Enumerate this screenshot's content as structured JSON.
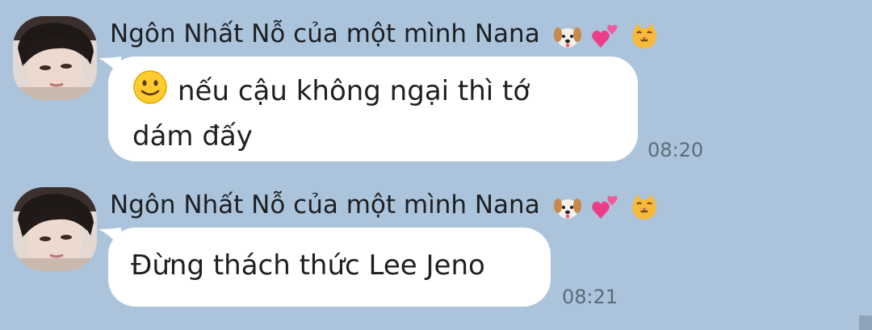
{
  "messages": [
    {
      "sender": "Ngôn Nhất Nỗ của một mình Nana",
      "sender_emojis": [
        "dog-face-emoji",
        "two-hearts-emoji",
        "cat-face-emoji"
      ],
      "leading_emoji": "slightly-smiling-face-emoji",
      "text_line1": "nếu cậu không ngại thì tớ",
      "text_line2": "dám đấy",
      "time": "08:20"
    },
    {
      "sender": "Ngôn Nhất Nỗ của một mình Nana",
      "sender_emojis": [
        "dog-face-emoji",
        "two-hearts-emoji",
        "cat-face-emoji"
      ],
      "text": "Đừng thách thức Lee Jeno",
      "time": "08:21"
    }
  ],
  "colors": {
    "background": "#abc4db",
    "bubble": "#ffffff",
    "text": "#1d1f22",
    "time": "#5d6b78"
  }
}
